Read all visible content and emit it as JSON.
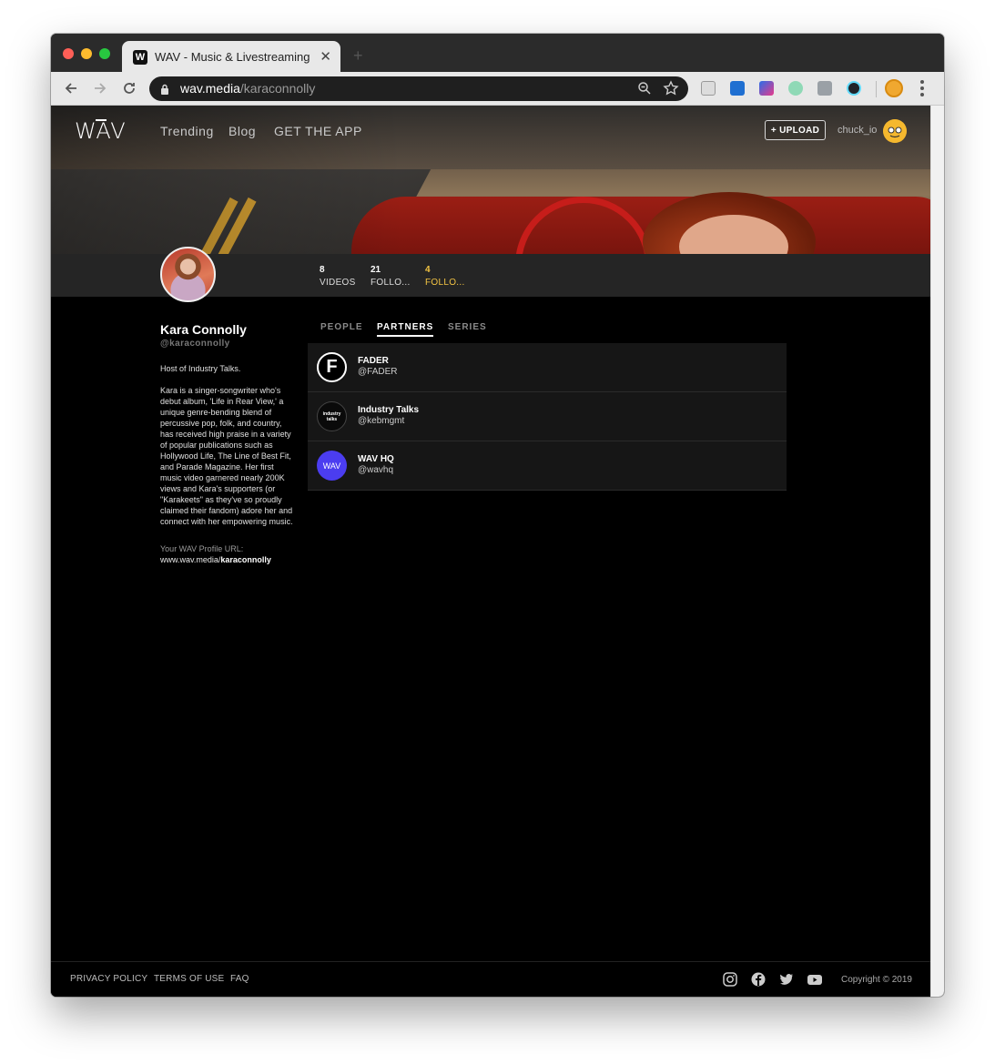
{
  "browser": {
    "tab_title": "WAV - Music & Livestreaming",
    "tab_favicon": "W",
    "url_domain": "wav.media",
    "url_path": "/karaconnolly"
  },
  "nav": {
    "logo": "WAV",
    "links": [
      "Trending",
      "Blog",
      "GET THE APP"
    ],
    "upload_label": "+ UPLOAD",
    "username": "chuck_io"
  },
  "profile": {
    "stats": [
      {
        "value": "8",
        "label": "VIDEOS"
      },
      {
        "value": "21",
        "label": "FOLLO..."
      },
      {
        "value": "4",
        "label": "FOLLO..."
      }
    ],
    "name": "Kara Connolly",
    "handle": "@karaconnolly",
    "bio_intro": "Host of Industry Talks.",
    "bio": "Kara is a singer-songwriter who's debut album, 'Life in Rear View,' a unique genre-bending blend of percussive pop, folk, and country, has received high praise in a variety of popular publications such as Hollywood Life, The Line of Best Fit, and Parade Magazine. Her first music video garnered nearly 200K views and Kara's supporters (or \"Karakeets\" as they've so proudly claimed their fandom) adore her and connect with her empowering music.",
    "url_label": "Your WAV Profile URL:",
    "url_prefix": "www.wav.media/",
    "url_handle": "karaconnolly"
  },
  "tabs": [
    "PEOPLE",
    "PARTNERS",
    "SERIES"
  ],
  "active_tab": "PARTNERS",
  "partners": [
    {
      "name": "FADER",
      "handle": "@FADER",
      "logo_text": "F"
    },
    {
      "name": "Industry Talks",
      "handle": "@kebmgmt",
      "logo_text": "industry talks"
    },
    {
      "name": "WAV HQ",
      "handle": "@wavhq",
      "logo_text": "WAV"
    }
  ],
  "footer": {
    "links": [
      "PRIVACY POLICY",
      "TERMS OF USE",
      "FAQ"
    ],
    "social_icons": [
      "instagram-icon",
      "facebook-icon",
      "twitter-icon",
      "youtube-icon"
    ],
    "copyright": "Copyright © 2019"
  },
  "colors": {
    "accent": "#f3c443",
    "wav_hq_purple": "#4b3df0",
    "background": "#000000",
    "stats_bar": "#252525"
  }
}
